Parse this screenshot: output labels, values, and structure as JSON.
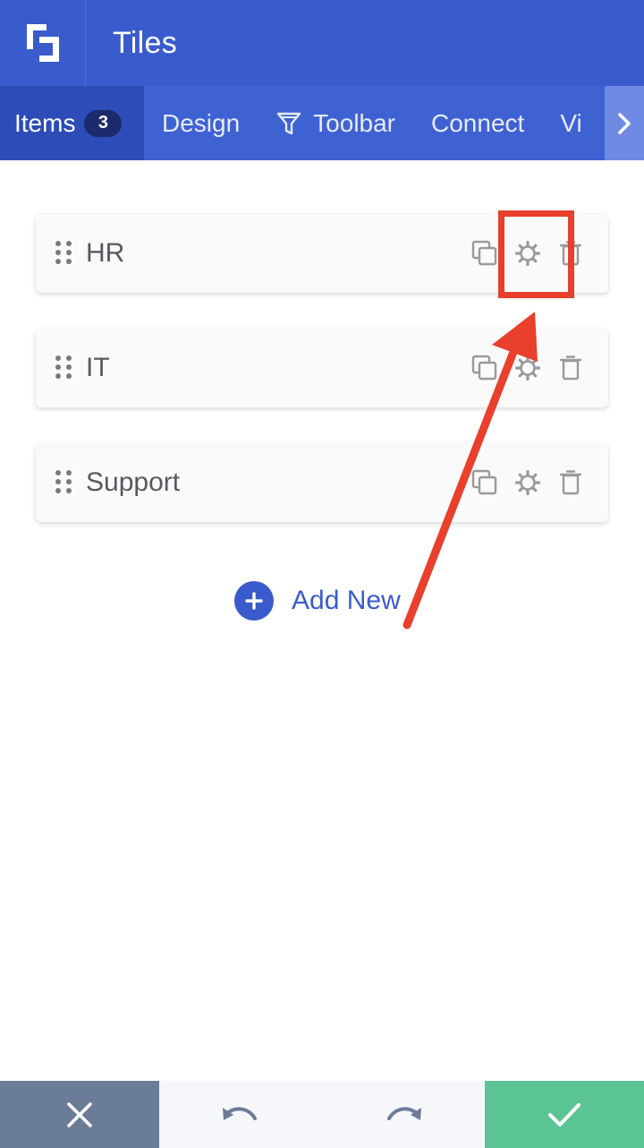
{
  "header": {
    "title": "Tiles",
    "logo_icon": "app-logo-icon"
  },
  "tabs": [
    {
      "label": "Items",
      "badge": "3",
      "active": true
    },
    {
      "label": "Design"
    },
    {
      "label": "Toolbar",
      "icon": "filter-icon"
    },
    {
      "label": "Connect"
    },
    {
      "label": "Vi"
    }
  ],
  "items": [
    {
      "label": "HR"
    },
    {
      "label": "IT"
    },
    {
      "label": "Support"
    }
  ],
  "add_new": {
    "label": "Add New"
  },
  "colors": {
    "primary": "#3a5bcc",
    "annotation": "#e8402c",
    "confirm": "#5bc494",
    "cancel": "#6b7c99"
  }
}
